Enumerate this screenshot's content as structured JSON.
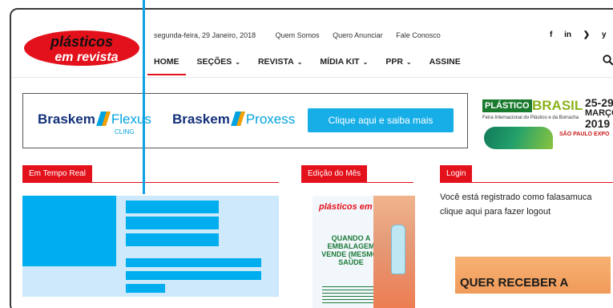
{
  "logo": {
    "line1": "plásticos",
    "line2": "em revista"
  },
  "topbar": {
    "date": "segunda-feira, 29 Janeiro, 2018",
    "links": [
      "Quem Somos",
      "Quero Anunciar",
      "Fale Conosco"
    ]
  },
  "social": [
    "f",
    "in",
    "rss",
    "y"
  ],
  "nav": {
    "items": [
      {
        "label": "HOME",
        "caret": ""
      },
      {
        "label": "SEÇÕES",
        "caret": "⌄"
      },
      {
        "label": "REVISTA",
        "caret": "⌄"
      },
      {
        "label": "MÍDIA KIT",
        "caret": "⌄"
      },
      {
        "label": "PPR",
        "caret": "⌄"
      },
      {
        "label": "ASSINE",
        "caret": ""
      }
    ],
    "search_icon": "🔍"
  },
  "banner": {
    "brand1": "Braskem",
    "product1": "Flexus",
    "product1_sub": "CLING",
    "brand2": "Braskem",
    "product2": "Proxess",
    "cta": "Clique aqui e saiba mais"
  },
  "plastico_brasil": {
    "plastico": "PLÁSTICO",
    "brasil": "BRASIL",
    "subtitle": "Feira Internacional do Plástico e da Borracha",
    "date_top": "25-29",
    "date_mid": "MARÇO",
    "date_year": "2019",
    "expo": "SÃO PAULO EXPO"
  },
  "sections": {
    "real_time": "Em Tempo Real",
    "edition": "Edição do Mês",
    "login": "Login"
  },
  "magazine": {
    "title": "plásticos em revista",
    "headline": "QUANDO A EMBALAGEM VENDE (MESMO) SAÚDE"
  },
  "login": {
    "line1": "Você está registrado como falasamuca",
    "line2": "clique aqui para fazer logout"
  },
  "ad": {
    "text": "QUER RECEBER A"
  },
  "colors": {
    "brand_red": "#e3111b",
    "accent_blue": "#00aeef",
    "braskem_navy": "#14317a"
  }
}
